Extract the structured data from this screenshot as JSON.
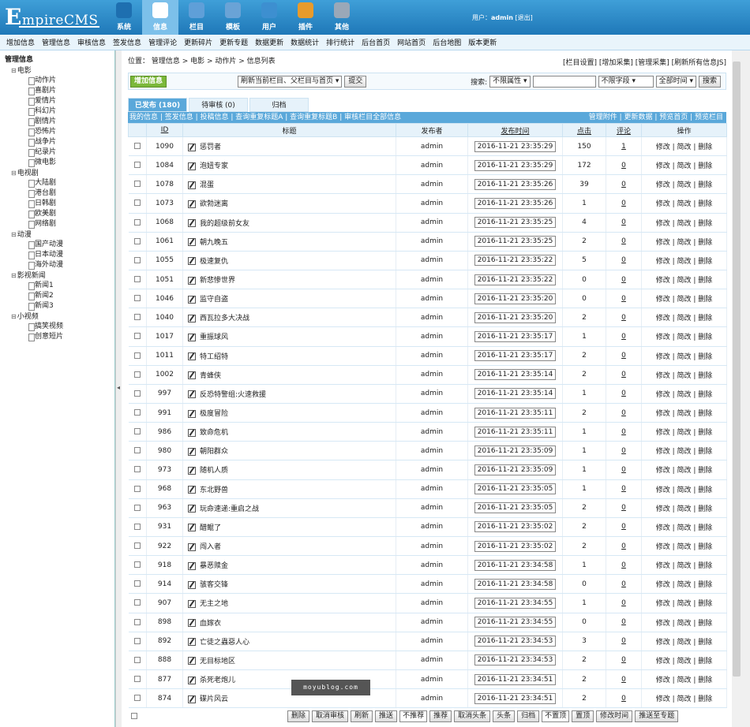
{
  "logo": {
    "big": "E",
    "rest": "mpireCMS"
  },
  "mainnav": [
    {
      "label": "系统",
      "color": "#1e6fb0"
    },
    {
      "label": "信息",
      "color": "#ffffff"
    },
    {
      "label": "栏目",
      "color": "#5f9fd8"
    },
    {
      "label": "模板",
      "color": "#6aa3d6"
    },
    {
      "label": "用户",
      "color": "#3d8fd0"
    },
    {
      "label": "插件",
      "color": "#e89b2c"
    },
    {
      "label": "其他",
      "color": "#9aa8b8"
    }
  ],
  "user": {
    "prefix": "用户：",
    "name": "admin",
    "logout": "[退出]"
  },
  "subnav": [
    "增加信息",
    "管理信息",
    "审核信息",
    "签发信息",
    "管理评论",
    "更新碎片",
    "更新专题",
    "数据更新",
    "数据统计",
    "排行统计",
    "后台首页",
    "网站首页",
    "后台地图",
    "版本更新"
  ],
  "tree": {
    "root": "管理信息",
    "cats": [
      {
        "name": "电影",
        "items": [
          "动作片",
          "喜剧片",
          "爱情片",
          "科幻片",
          "剧情片",
          "恐怖片",
          "战争片",
          "纪录片",
          "微电影"
        ]
      },
      {
        "name": "电视剧",
        "items": [
          "大陆剧",
          "港台剧",
          "日韩剧",
          "欧美剧",
          "网络剧"
        ]
      },
      {
        "name": "动漫",
        "items": [
          "国产动漫",
          "日本动漫",
          "海外动漫"
        ]
      },
      {
        "name": "影视新闻",
        "items": [
          "新闻1",
          "新闻2",
          "新闻3"
        ]
      },
      {
        "name": "小视频",
        "items": [
          "搞笑视频",
          "创意短片"
        ]
      }
    ]
  },
  "crumb": {
    "text": "位置： 管理信息 > 电影 > 动作片 > 信息列表",
    "right": "[栏目设置] [增加采集] [管理采集] [刷新所有信息JS]"
  },
  "toolbar": {
    "add": "增加信息",
    "refresh_select": "刷新当前栏目、父栏目与首页",
    "submit": "提交",
    "search_label": "搜索:",
    "attr": "不限属性",
    "field": "不限字段",
    "time": "全部时间",
    "search": "搜索"
  },
  "tabs": [
    "已发布 (180)",
    "待审核 (0)",
    "归档"
  ],
  "linkbar": {
    "left": "我的信息 | 签发信息 | 投稿信息 | 查询重复标题A | 查询重复标题B | 审核栏目全部信息",
    "right": "管理附件 | 更新数据 | 预览首页 | 预览栏目"
  },
  "headers": [
    "",
    "ID",
    "标题",
    "发布者",
    "发布时间",
    "点击",
    "评论",
    "操作"
  ],
  "ops": "修改 | 简改 | 删除",
  "rows": [
    {
      "id": "1090",
      "title": "惩罚者",
      "user": "admin",
      "time": "2016-11-21 23:35:29",
      "hits": "150",
      "cmt": "1"
    },
    {
      "id": "1084",
      "title": "泡妞专家",
      "user": "admin",
      "time": "2016-11-21 23:35:29",
      "hits": "172",
      "cmt": "0"
    },
    {
      "id": "1078",
      "title": "混蛋",
      "user": "admin",
      "time": "2016-11-21 23:35:26",
      "hits": "39",
      "cmt": "0"
    },
    {
      "id": "1073",
      "title": "欲勃迷离",
      "user": "admin",
      "time": "2016-11-21 23:35:26",
      "hits": "1",
      "cmt": "0"
    },
    {
      "id": "1068",
      "title": "我的超级前女友",
      "user": "admin",
      "time": "2016-11-21 23:35:25",
      "hits": "4",
      "cmt": "0"
    },
    {
      "id": "1061",
      "title": "朝九晚五",
      "user": "admin",
      "time": "2016-11-21 23:35:25",
      "hits": "2",
      "cmt": "0"
    },
    {
      "id": "1055",
      "title": "极速复仇",
      "user": "admin",
      "time": "2016-11-21 23:35:22",
      "hits": "5",
      "cmt": "0"
    },
    {
      "id": "1051",
      "title": "新悲惨世界",
      "user": "admin",
      "time": "2016-11-21 23:35:22",
      "hits": "0",
      "cmt": "0"
    },
    {
      "id": "1046",
      "title": "监守自盗",
      "user": "admin",
      "time": "2016-11-21 23:35:20",
      "hits": "0",
      "cmt": "0"
    },
    {
      "id": "1040",
      "title": "西瓦拉多大决战",
      "user": "admin",
      "time": "2016-11-21 23:35:20",
      "hits": "2",
      "cmt": "0"
    },
    {
      "id": "1017",
      "title": "重振球风",
      "user": "admin",
      "time": "2016-11-21 23:35:17",
      "hits": "1",
      "cmt": "0"
    },
    {
      "id": "1011",
      "title": "特工绍特",
      "user": "admin",
      "time": "2016-11-21 23:35:17",
      "hits": "2",
      "cmt": "0"
    },
    {
      "id": "1002",
      "title": "青蜂侠",
      "user": "admin",
      "time": "2016-11-21 23:35:14",
      "hits": "2",
      "cmt": "0"
    },
    {
      "id": "997",
      "title": "反恐特警组:火速救援",
      "user": "admin",
      "time": "2016-11-21 23:35:14",
      "hits": "1",
      "cmt": "0"
    },
    {
      "id": "991",
      "title": "极度冒险",
      "user": "admin",
      "time": "2016-11-21 23:35:11",
      "hits": "2",
      "cmt": "0"
    },
    {
      "id": "986",
      "title": "致命危机",
      "user": "admin",
      "time": "2016-11-21 23:35:11",
      "hits": "1",
      "cmt": "0"
    },
    {
      "id": "980",
      "title": "朝阳群众",
      "user": "admin",
      "time": "2016-11-21 23:35:09",
      "hits": "1",
      "cmt": "0"
    },
    {
      "id": "973",
      "title": "随机人质",
      "user": "admin",
      "time": "2016-11-21 23:35:09",
      "hits": "1",
      "cmt": "0"
    },
    {
      "id": "968",
      "title": "东北野兽",
      "user": "admin",
      "time": "2016-11-21 23:35:05",
      "hits": "1",
      "cmt": "0"
    },
    {
      "id": "963",
      "title": "玩命速递:重启之战",
      "user": "admin",
      "time": "2016-11-21 23:35:05",
      "hits": "2",
      "cmt": "0"
    },
    {
      "id": "931",
      "title": "醋鲲了",
      "user": "admin",
      "time": "2016-11-21 23:35:02",
      "hits": "2",
      "cmt": "0"
    },
    {
      "id": "922",
      "title": "闯入者",
      "user": "admin",
      "time": "2016-11-21 23:35:02",
      "hits": "2",
      "cmt": "0"
    },
    {
      "id": "918",
      "title": "暴恶赎金",
      "user": "admin",
      "time": "2016-11-21 23:34:58",
      "hits": "1",
      "cmt": "0"
    },
    {
      "id": "914",
      "title": "骇客交锋",
      "user": "admin",
      "time": "2016-11-21 23:34:58",
      "hits": "0",
      "cmt": "0"
    },
    {
      "id": "907",
      "title": "无主之地",
      "user": "admin",
      "time": "2016-11-21 23:34:55",
      "hits": "1",
      "cmt": "0"
    },
    {
      "id": "898",
      "title": "血嫁衣",
      "user": "admin",
      "time": "2016-11-21 23:34:55",
      "hits": "0",
      "cmt": "0"
    },
    {
      "id": "892",
      "title": "亡徒之蟲惡人心",
      "user": "admin",
      "time": "2016-11-21 23:34:53",
      "hits": "3",
      "cmt": "0"
    },
    {
      "id": "888",
      "title": "无目标地区",
      "user": "admin",
      "time": "2016-11-21 23:34:53",
      "hits": "2",
      "cmt": "0"
    },
    {
      "id": "877",
      "title": "杀死老炮儿",
      "user": "admin",
      "time": "2016-11-21 23:34:51",
      "hits": "2",
      "cmt": "0"
    },
    {
      "id": "874",
      "title": "碟片风云",
      "user": "admin",
      "time": "2016-11-21 23:34:51",
      "hits": "2",
      "cmt": "0"
    }
  ],
  "bottom": [
    "删除",
    "取消审核",
    "刷新",
    "推送",
    "不推荐",
    "推荐",
    "取消头条",
    "头条",
    "归档",
    "不置顶",
    "置顶",
    "修改时间",
    "推送至专题"
  ],
  "watermark": "moyublog.com"
}
